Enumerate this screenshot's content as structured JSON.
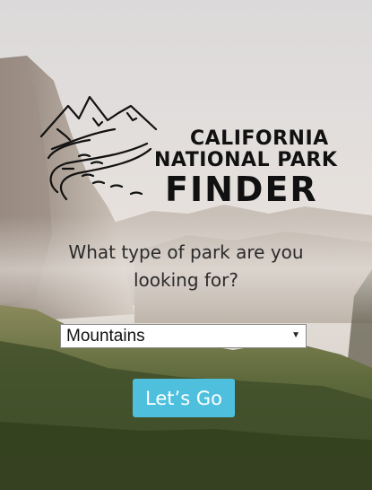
{
  "brand": {
    "line1": "CALIFORNIA",
    "line2": "NATIONAL PARK",
    "line3": "FINDER"
  },
  "question": {
    "line1": "What type of park are you",
    "line2": "looking for?"
  },
  "park_type_select": {
    "selected": "Mountains"
  },
  "go_button": {
    "label": "Let’s Go"
  },
  "colors": {
    "button_bg": "#4ec0de",
    "button_text": "#ffffff",
    "logo_ink": "#111111"
  }
}
